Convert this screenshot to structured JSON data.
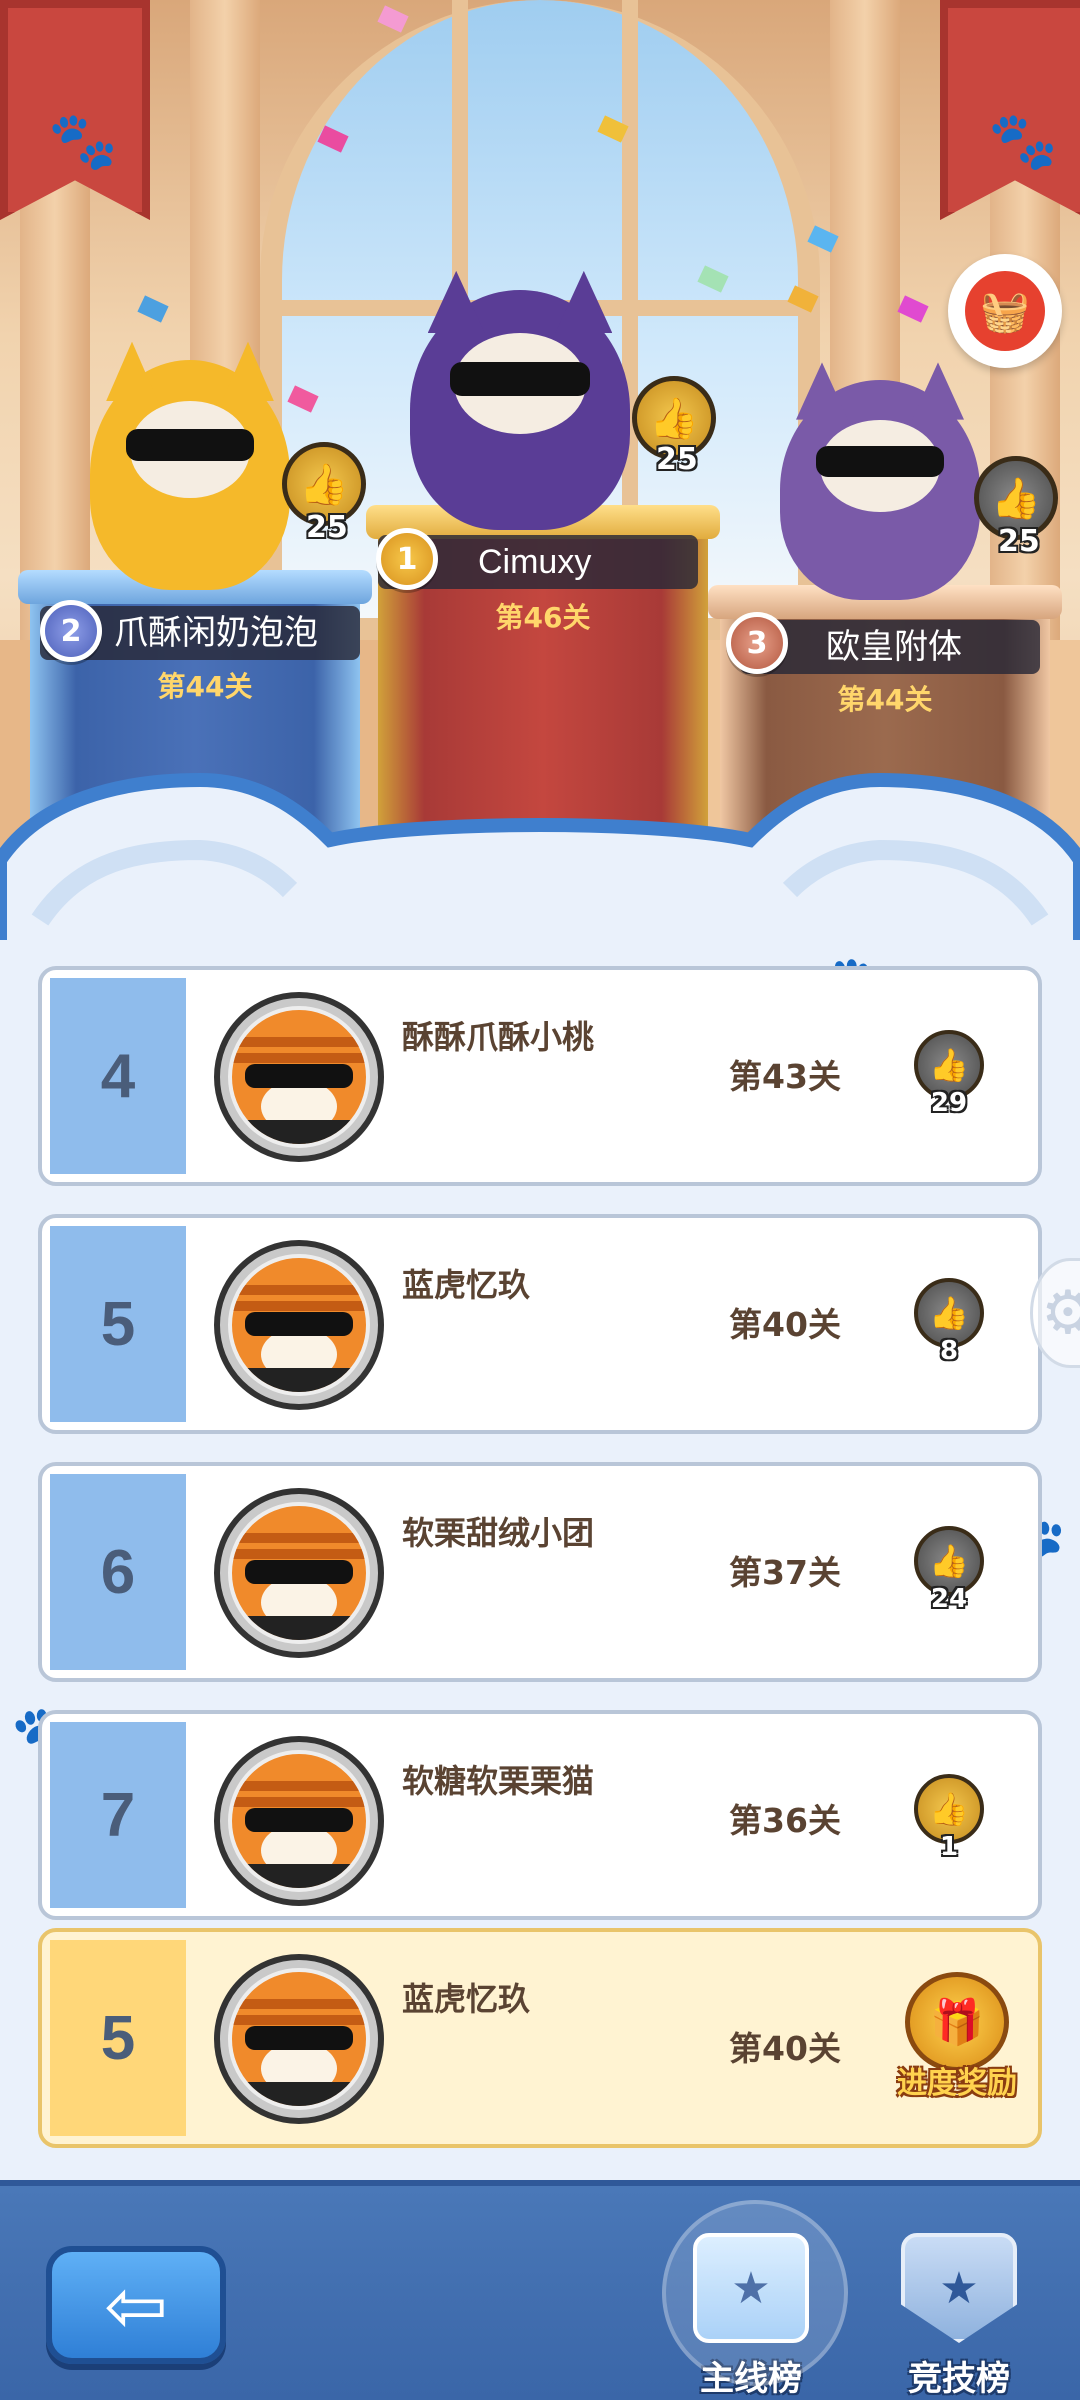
{
  "podium": {
    "first": {
      "rank": "1",
      "name": "Cimuxy",
      "level": "第46关",
      "likes": "25"
    },
    "second": {
      "rank": "2",
      "name": "爪酥闲奶泡泡",
      "level": "第44关",
      "likes": "25"
    },
    "third": {
      "rank": "3",
      "name": "欧皇附体",
      "level": "第44关",
      "likes": "25"
    }
  },
  "rows": [
    {
      "rank": "4",
      "name": "酥酥爪酥小桃",
      "level": "第43关",
      "likes": "29",
      "like_style": "grey"
    },
    {
      "rank": "5",
      "name": "蓝虎忆玖",
      "level": "第40关",
      "likes": "8",
      "like_style": "grey"
    },
    {
      "rank": "6",
      "name": "软栗甜绒小团",
      "level": "第37关",
      "likes": "24",
      "like_style": "grey"
    },
    {
      "rank": "7",
      "name": "软糖软栗栗猫",
      "level": "第36关",
      "likes": "1",
      "like_style": "gold"
    }
  ],
  "me": {
    "rank": "5",
    "name": "蓝虎忆玖",
    "level": "第40关",
    "reward_label": "进度奖励"
  },
  "tabs": {
    "main": "主线榜",
    "arena": "竞技榜"
  },
  "colors": {
    "gold": "#d8911e",
    "blue_rank": "#8fbcec",
    "me_rank": "#ffd779",
    "bar": "#3a66a8"
  },
  "icons": {
    "like": "thumbs-up-icon",
    "back": "arrow-left-icon",
    "reward": "treasure-chest-icon",
    "main_tab": "podium-icon",
    "arena_tab": "shield-star-icon"
  }
}
